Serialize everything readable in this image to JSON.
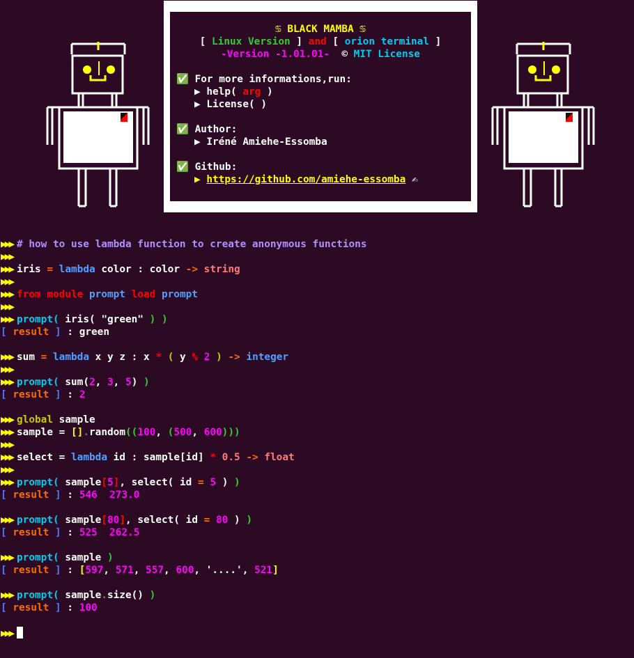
{
  "banner": {
    "title": "♋ BLACK MAMBA ♋",
    "open_bracket": "[",
    "linux_version": "Linux Version",
    "close_bracket": "]",
    "and": "and",
    "orion_terminal": "orion terminal",
    "version": "-Version -1.01.01-",
    "copyright_symbol": "©",
    "license": "MIT License",
    "check": "✅",
    "more_info": "For more informations,run:",
    "pointer": "▶",
    "help_fn": "help(",
    "help_arg": "arg",
    "help_close": ")",
    "license_fn": "License( )",
    "author_label": "Author:",
    "author_name": "Iréné Amiehe-Essomba",
    "github_label": "Github:",
    "github_url": "https://github.com/amiehe-essomba",
    "writing_hand": "✍"
  },
  "prompt_symbol": "▶▶▶",
  "terminal": {
    "comment": "# how to use lambda function to create anonymous functions",
    "iris_name": "iris",
    "eq": "=",
    "lambda": "lambda",
    "color_arg": "color",
    "colon": ":",
    "color_body": "color",
    "arrow": "->",
    "string_type": "string",
    "from": "from",
    "module": "module",
    "prompt_mod": "prompt",
    "load": "load",
    "prompt_load": "prompt",
    "prompt_fn": "prompt(",
    "iris_call": "iris(",
    "green_str": "\"green\"",
    "close_pair": ") )",
    "result_open": "[",
    "result_word": "result",
    "result_close": "]",
    "result1": "green",
    "sum_name": "sum",
    "xyz": "x y z",
    "x": "x",
    "star": "*",
    "lparen": "(",
    "y": "y",
    "pct": "%",
    "two": "2",
    "rparen": ")",
    "integer_type": "integer",
    "sum_call": "sum(",
    "n2": "2",
    "comma": ",",
    "n3": "3",
    "n5": "5",
    "result2": "2",
    "global_kw": "global",
    "sample": "sample",
    "brackets": "[]",
    "dot": ".",
    "random": "random",
    "lpp": "((",
    "n100": "100",
    "n500": "500",
    "n600": "600",
    "rpp": ")))",
    "select": "select",
    "id": "id",
    "lbr": "[",
    "rbr": "]",
    "half": "0.5",
    "float_type": "float",
    "select_call": "select(",
    "idx5": "5",
    "rp": ")",
    "result3a": "546",
    "result3b": "273.0",
    "idx80": "80",
    "result4a": "525",
    "result4b": "262.5",
    "result5": {
      "v1": "597",
      "v2": "571",
      "v3": "557",
      "v4": "600",
      "v5": "'....'",
      "v6": "521"
    },
    "size": "size",
    "empty_call": "()",
    "result6": "100"
  },
  "colors": {
    "background": "#2c0a23",
    "prompt": "#ffff00",
    "keyword": "#00ccee",
    "string": "#ff7b7b",
    "number": "#ff00ff",
    "paren": "#33cc33",
    "operator": "#ff6a00"
  }
}
